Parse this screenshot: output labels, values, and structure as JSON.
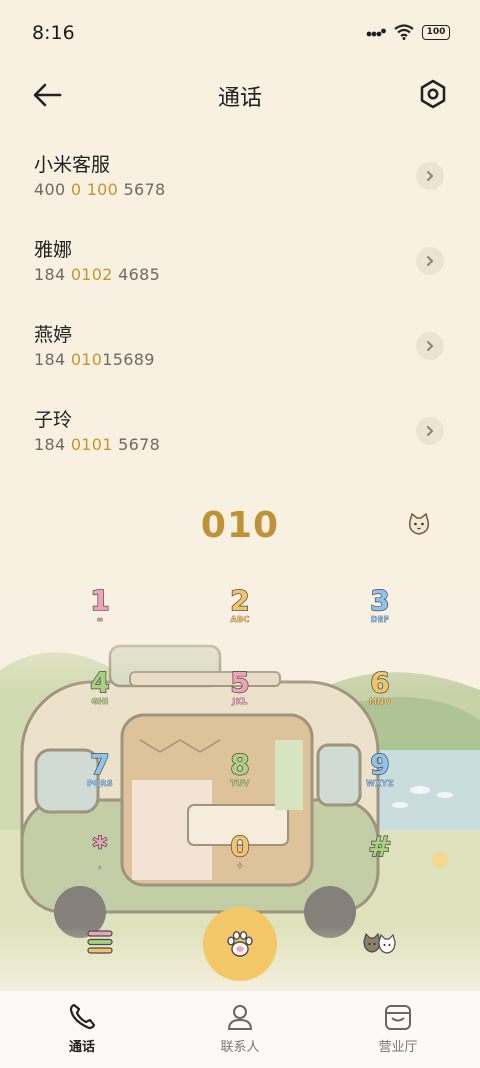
{
  "status_bar": {
    "time": "8:16",
    "battery": "100"
  },
  "header": {
    "title": "通话"
  },
  "contacts": [
    {
      "name": "小米客服",
      "number_parts": [
        "400 ",
        "0",
        " ",
        "100",
        " 5678"
      ]
    },
    {
      "name": "雅娜",
      "number_parts": [
        "184 ",
        "0102",
        " 4685",
        "",
        ""
      ]
    },
    {
      "name": "燕婷",
      "number_parts": [
        "184 ",
        "010",
        "15689",
        "",
        ""
      ]
    },
    {
      "name": "子玲",
      "number_parts": [
        "184 ",
        "0101",
        " 5678",
        "",
        ""
      ]
    }
  ],
  "dialer": {
    "input": "010"
  },
  "keypad": [
    {
      "digit": "1",
      "letters": "∞",
      "color": "#f0a3b8"
    },
    {
      "digit": "2",
      "letters": "ABC",
      "color": "#f3c36a"
    },
    {
      "digit": "3",
      "letters": "DEF",
      "color": "#8fc3ef"
    },
    {
      "digit": "4",
      "letters": "GHI",
      "color": "#a9d27f"
    },
    {
      "digit": "5",
      "letters": "JKL",
      "color": "#f0a3b8"
    },
    {
      "digit": "6",
      "letters": "MNO",
      "color": "#f3c36a"
    },
    {
      "digit": "7",
      "letters": "PQRS",
      "color": "#8fc3ef"
    },
    {
      "digit": "8",
      "letters": "TUV",
      "color": "#a9d27f"
    },
    {
      "digit": "9",
      "letters": "WXYZ",
      "color": "#8fc3ef"
    },
    {
      "digit": "*",
      "letters": ",",
      "color": "#f0a3b8"
    },
    {
      "digit": "0",
      "letters": "+",
      "color": "#f3c36a"
    },
    {
      "digit": "#",
      "letters": "",
      "color": "#a9d27f"
    }
  ],
  "bottom_nav": [
    {
      "label": "通话",
      "icon": "phone-icon",
      "active": true
    },
    {
      "label": "联系人",
      "icon": "person-icon",
      "active": false
    },
    {
      "label": "营业厅",
      "icon": "store-icon",
      "active": false
    }
  ],
  "colors": {
    "accent": "#c09238",
    "call_button": "#f4c768",
    "background": "#f8f1e2"
  }
}
